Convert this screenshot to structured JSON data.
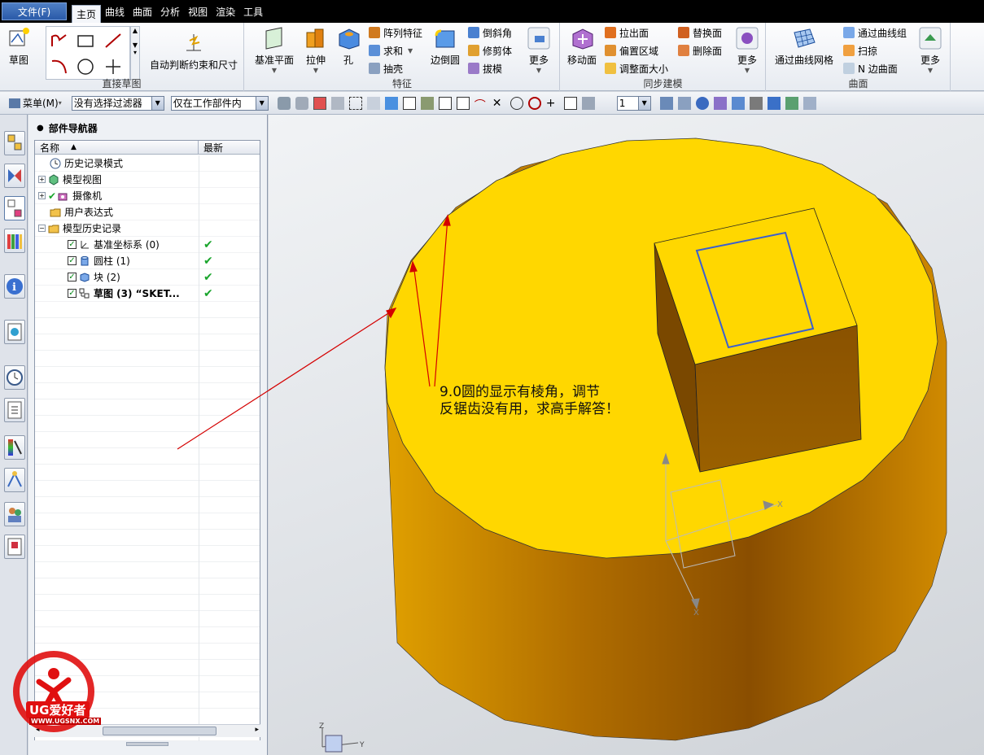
{
  "menubar": {
    "file": "文件(F)",
    "tabs": [
      "主页",
      "曲线",
      "曲面",
      "分析",
      "视图",
      "渲染",
      "工具"
    ]
  },
  "ribbon": {
    "sketch_label": "草图",
    "auto_dims_label": "自动判断约束和尺寸",
    "direct_sketch_group": "直接草图",
    "datum_plane": "基准平面",
    "extrude": "拉伸",
    "hole": "孔",
    "pattern_feature": "阵列特征",
    "unite": "求和",
    "shell": "抽壳",
    "edge_blend": "边倒圆",
    "chamfer": "倒斜角",
    "trim_body": "修剪体",
    "draft": "拔模",
    "more": "更多",
    "feature_group": "特征",
    "move_face": "移动面",
    "pull_face": "拉出面",
    "offset_region": "偏置区域",
    "resize_face": "调整面大小",
    "replace_face": "替换面",
    "delete_face": "删除面",
    "sync_group": "同步建模",
    "through_curve_mesh": "通过曲线网格",
    "through_curves": "通过曲线组",
    "swept": "扫掠",
    "n_sided": "N 边曲面",
    "surface_group": "曲面"
  },
  "toolbar2": {
    "menu_label": "菜单(M)",
    "filter": "没有选择过滤器",
    "scope": "仅在工作部件内",
    "layer_value": "1"
  },
  "navigator": {
    "title": "部件导航器",
    "col_name": "名称",
    "col_latest": "最新",
    "rows": [
      {
        "label": "历史记录模式",
        "latest": ""
      },
      {
        "label": "模型视图",
        "latest": ""
      },
      {
        "label": "摄像机",
        "latest": ""
      },
      {
        "label": "用户表达式",
        "latest": ""
      },
      {
        "label": "模型历史记录",
        "latest": ""
      },
      {
        "label": "基准坐标系 (0)",
        "latest": "✔"
      },
      {
        "label": "圆柱 (1)",
        "latest": "✔"
      },
      {
        "label": "块 (2)",
        "latest": "✔"
      },
      {
        "label": "草图 (3) “SKET...",
        "latest": "✔"
      }
    ]
  },
  "viewport": {
    "annotation_line1": "9.0圆的显示有棱角，调节",
    "annotation_line2": "反锯齿没有用，求高手解答！"
  },
  "watermark": {
    "brand": "UG爱好者",
    "url": "WWW.UGSNX.COM"
  },
  "colors": {
    "top_face": "#ffd400",
    "side_face": "#c87800",
    "annotation_arrow": "#d40000"
  }
}
